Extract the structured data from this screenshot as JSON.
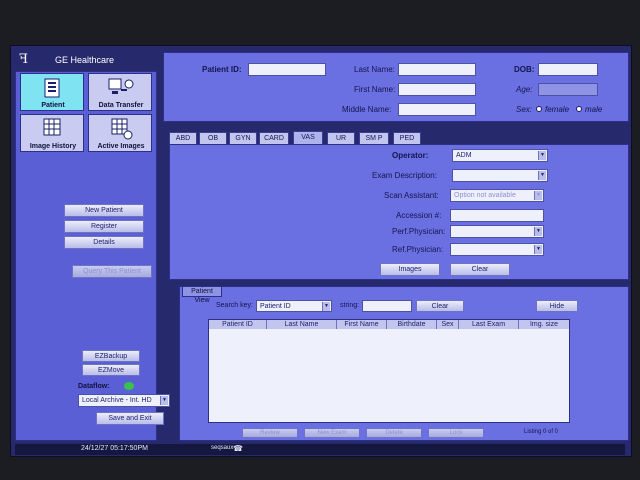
{
  "logo": {
    "text": "GE Healthcare"
  },
  "nav": {
    "patient": "Patient",
    "data_transfer": "Data Transfer",
    "image_history": "Image History",
    "active_images": "Active Images"
  },
  "left_buttons": {
    "new_patient": "New Patient",
    "register": "Register",
    "details": "Details",
    "query_this_patient": "Query This Patient",
    "ezbackup": "EZBackup",
    "ezmove": "EZMove",
    "save_and_exit": "Save and Exit"
  },
  "dataflow": {
    "label": "Dataflow:",
    "value": "Local Archive - Int. HD"
  },
  "patient_header": {
    "patient_id_label": "Patient ID:",
    "patient_id_value": "",
    "last_name_label": "Last Name:",
    "last_name_value": "",
    "first_name_label": "First Name:",
    "first_name_value": "",
    "middle_name_label": "Middle Name:",
    "middle_name_value": "",
    "dob_label": "DOB:",
    "dob_value": "",
    "age_label": "Age:",
    "age_value": "",
    "sex_label": "Sex:",
    "sex_female": "female",
    "sex_male": "male"
  },
  "tabs": [
    "ABD",
    "OB",
    "GYN",
    "CARD",
    "VAS",
    "UR",
    "SM P",
    "PED"
  ],
  "active_tab": "VAS",
  "exam": {
    "operator_label": "Operator:",
    "operator_value": "ADM",
    "exam_description_label": "Exam Description:",
    "exam_description_value": "",
    "scan_assistant_label": "Scan Assistant:",
    "scan_assistant_value": "Option not available",
    "accession_label": "Accession #:",
    "accession_value": "",
    "perf_physician_label": "Perf.Physician:",
    "perf_physician_value": "",
    "ref_physician_label": "Ref.Physician:",
    "ref_physician_value": "",
    "images_button": "Images",
    "clear_button": "Clear"
  },
  "patient_view": {
    "title": "Patient View",
    "search_key_label": "Search key:",
    "search_key_value": "Patient ID",
    "string_label": "string:",
    "string_value": "",
    "clear_button": "Clear",
    "hide_button": "Hide",
    "columns": [
      "Patient ID",
      "Last Name",
      "First Name",
      "Birthdate",
      "Sex",
      "Last Exam",
      "Img. size"
    ],
    "rows": [],
    "bottom_buttons": [
      "Review",
      "New Exam",
      "Delete",
      "Lock"
    ],
    "listing": "Listing 0 of 0"
  },
  "status_bar": {
    "datetime": "24/12/27 05:17:50PM",
    "user": "seqsaux"
  },
  "colors": {
    "background": "#262a6c",
    "panel": "#5a5fd6",
    "panel_light": "#6a6fe2",
    "highlight": "#7fe3f2",
    "status_led": "#39c24a"
  }
}
